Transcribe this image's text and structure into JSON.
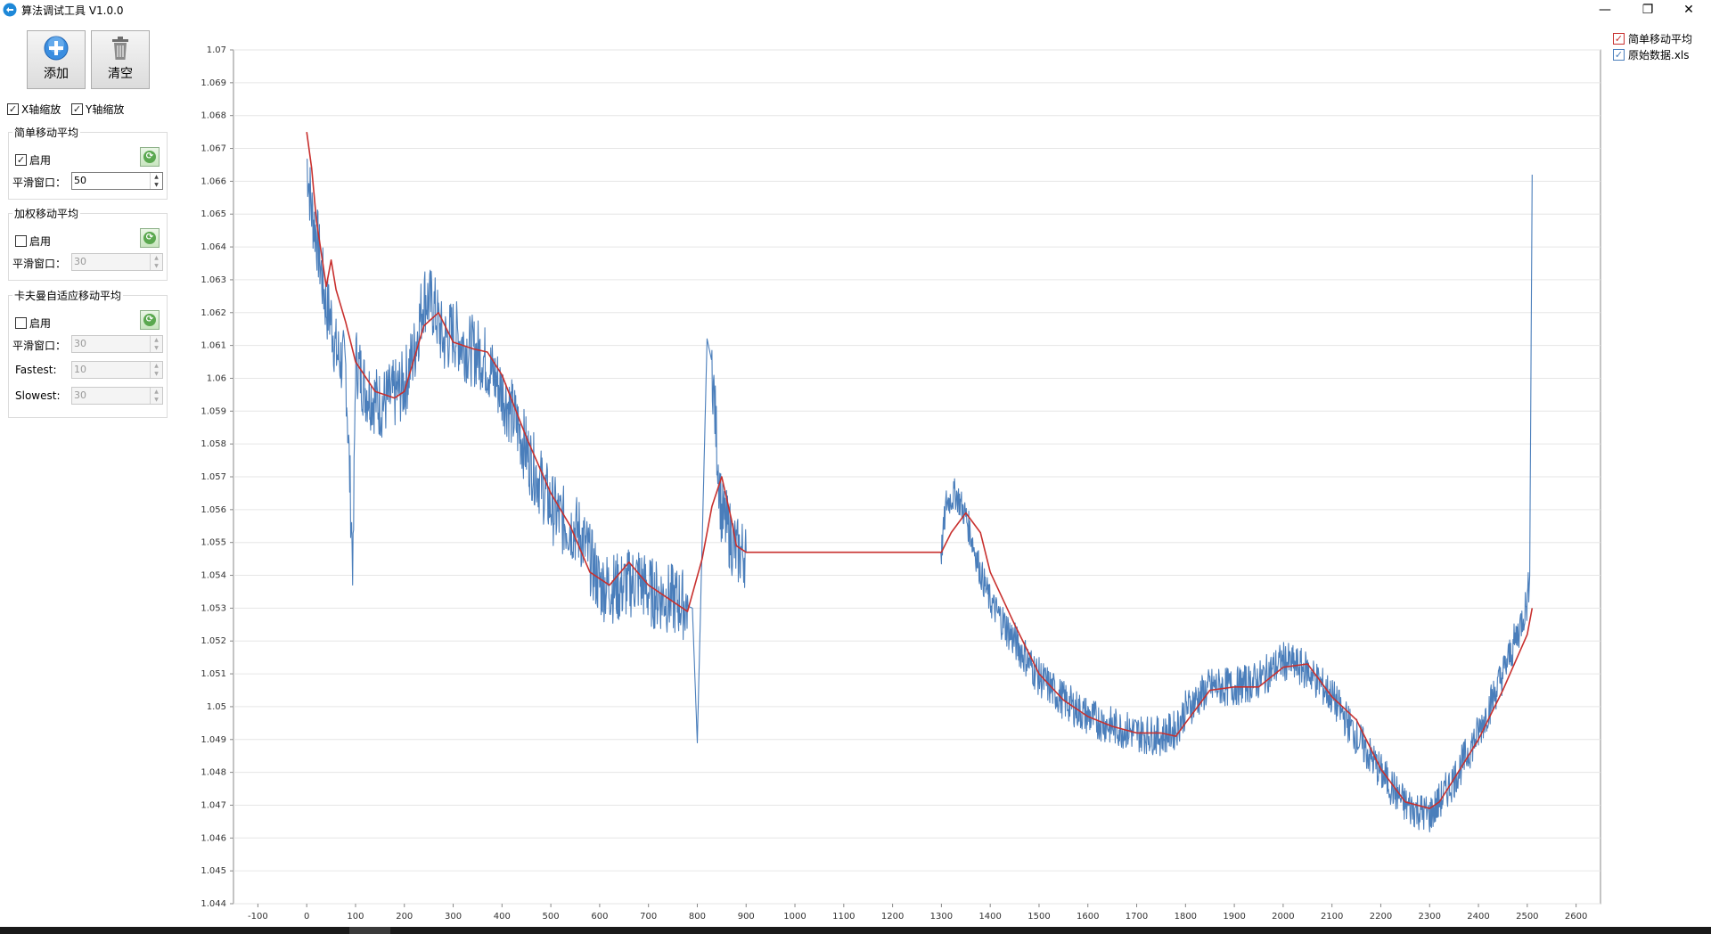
{
  "window": {
    "title": "算法调试工具 V1.0.0",
    "minimize_label": "—",
    "restore_label": "❐",
    "close_label": "✕"
  },
  "toolbar": {
    "add_label": "添加",
    "clear_label": "清空"
  },
  "axis_zoom": {
    "x_label": "X轴缩放",
    "y_label": "Y轴缩放",
    "x_checked": true,
    "y_checked": true
  },
  "sma": {
    "title": "简单移动平均",
    "enable_label": "启用",
    "enabled": true,
    "window_label": "平滑窗口：",
    "window_value": "50"
  },
  "wma": {
    "title": "加权移动平均",
    "enable_label": "启用",
    "enabled": false,
    "window_label": "平滑窗口：",
    "window_value": "30"
  },
  "kama": {
    "title": "卡夫曼自适应移动平均",
    "enable_label": "启用",
    "enabled": false,
    "window_label": "平滑窗口：",
    "window_value": "30",
    "fastest_label": "Fastest:",
    "fastest_value": "10",
    "slowest_label": "Slowest:",
    "slowest_value": "30"
  },
  "legend": {
    "items": [
      {
        "label": "简单移动平均",
        "checked": true,
        "color": "#c8302e"
      },
      {
        "label": "原始数据.xls",
        "checked": true,
        "color": "#4a7ebb"
      }
    ]
  },
  "chart_data": {
    "type": "line",
    "xlim": [
      -150,
      2650
    ],
    "ylim": [
      1.044,
      1.07
    ],
    "x_ticks": [
      -100,
      0,
      100,
      200,
      300,
      400,
      500,
      600,
      700,
      800,
      900,
      1000,
      1100,
      1200,
      1300,
      1400,
      1500,
      1600,
      1700,
      1800,
      1900,
      2000,
      2100,
      2200,
      2300,
      2400,
      2500,
      2600
    ],
    "y_ticks": [
      "1.044",
      "1.045",
      "1.046",
      "1.047",
      "1.048",
      "1.049",
      "1.05",
      "1.051",
      "1.052",
      "1.053",
      "1.054",
      "1.055",
      "1.056",
      "1.057",
      "1.058",
      "1.059",
      "1.06",
      "1.061",
      "1.062",
      "1.063",
      "1.064",
      "1.065",
      "1.066",
      "1.067",
      "1.068",
      "1.069",
      "1.07"
    ],
    "grid": true,
    "series": [
      {
        "name": "原始数据.xls",
        "color": "#4a7ebb",
        "x": [
          0,
          10,
          20,
          30,
          40,
          50,
          60,
          80,
          95,
          100,
          120,
          150,
          180,
          200,
          220,
          240,
          260,
          280,
          300,
          330,
          360,
          400,
          430,
          460,
          480,
          500,
          520,
          560,
          600,
          640,
          680,
          700,
          720,
          760,
          790,
          800,
          810,
          820,
          830,
          840,
          850,
          860,
          870,
          880,
          900,
          1000,
          1100,
          1200,
          1300,
          1310,
          1330,
          1350,
          1380,
          1400,
          1450,
          1500,
          1550,
          1600,
          1650,
          1700,
          1750,
          1780,
          1800,
          1850,
          1900,
          1950,
          2000,
          2050,
          2100,
          2150,
          2200,
          2250,
          2300,
          2320,
          2350,
          2400,
          2450,
          2480,
          2500,
          2505,
          2510
        ],
        "values": [
          1.0667,
          1.0651,
          1.0644,
          1.0632,
          1.0622,
          1.0618,
          1.0608,
          1.0603,
          1.0542,
          1.0606,
          1.0597,
          1.0592,
          1.0595,
          1.0598,
          1.0608,
          1.0625,
          1.0622,
          1.0611,
          1.0614,
          1.0609,
          1.0607,
          1.0596,
          1.0586,
          1.0574,
          1.0568,
          1.0561,
          1.0557,
          1.0553,
          1.0537,
          1.0536,
          1.0539,
          1.0535,
          1.0534,
          1.0532,
          1.053,
          1.0489,
          1.055,
          1.0612,
          1.0605,
          1.058,
          1.0558,
          1.0555,
          1.0551,
          1.0547,
          1.0547,
          1.0547,
          1.0547,
          1.0547,
          1.0547,
          1.0562,
          1.0565,
          1.0558,
          1.0541,
          1.0532,
          1.052,
          1.0509,
          1.0502,
          1.0497,
          1.0494,
          1.0492,
          1.0491,
          1.0493,
          1.0499,
          1.0506,
          1.0506,
          1.0508,
          1.0514,
          1.0511,
          1.0503,
          1.0491,
          1.048,
          1.047,
          1.0467,
          1.0471,
          1.0478,
          1.0492,
          1.051,
          1.0522,
          1.0532,
          1.054,
          1.0662
        ]
      },
      {
        "name": "简单移动平均",
        "color": "#c8302e",
        "x": [
          0,
          10,
          20,
          30,
          40,
          50,
          60,
          80,
          100,
          140,
          180,
          200,
          220,
          240,
          270,
          300,
          340,
          370,
          400,
          450,
          500,
          540,
          580,
          620,
          660,
          700,
          740,
          780,
          810,
          830,
          850,
          870,
          880,
          900,
          1000,
          1100,
          1200,
          1300,
          1320,
          1350,
          1380,
          1400,
          1450,
          1500,
          1550,
          1600,
          1650,
          1700,
          1750,
          1780,
          1800,
          1850,
          1900,
          1950,
          2000,
          2050,
          2100,
          2150,
          2200,
          2250,
          2300,
          2320,
          2350,
          2400,
          2450,
          2500,
          2510
        ],
        "values": [
          1.0675,
          1.0664,
          1.0648,
          1.0638,
          1.0628,
          1.0636,
          1.0627,
          1.0617,
          1.0605,
          1.0596,
          1.0594,
          1.0596,
          1.0606,
          1.0616,
          1.062,
          1.0611,
          1.0609,
          1.0608,
          1.0601,
          1.0582,
          1.0565,
          1.0555,
          1.0541,
          1.0537,
          1.0544,
          1.0537,
          1.0533,
          1.0529,
          1.0545,
          1.0561,
          1.057,
          1.0557,
          1.0549,
          1.0547,
          1.0547,
          1.0547,
          1.0547,
          1.0547,
          1.0553,
          1.0559,
          1.0553,
          1.0541,
          1.0525,
          1.051,
          1.0502,
          1.0497,
          1.0494,
          1.0492,
          1.0492,
          1.0491,
          1.0495,
          1.0505,
          1.0506,
          1.0506,
          1.0512,
          1.0513,
          1.0503,
          1.0496,
          1.0481,
          1.0471,
          1.0469,
          1.0471,
          1.0478,
          1.049,
          1.0505,
          1.0522,
          1.053
        ]
      }
    ]
  }
}
